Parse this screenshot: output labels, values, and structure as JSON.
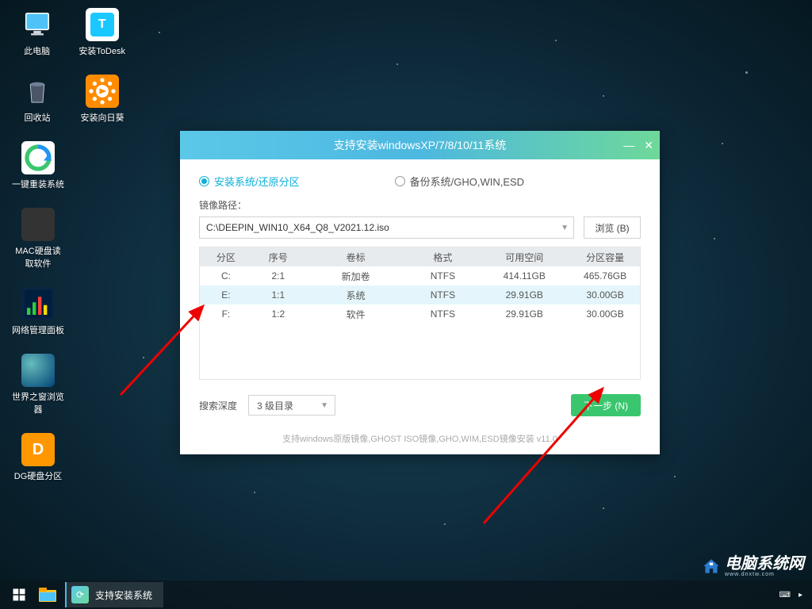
{
  "desktop": [
    [
      {
        "name": "pc",
        "label": "此电脑"
      },
      {
        "name": "todesk",
        "label": "安装ToDesk"
      }
    ],
    [
      {
        "name": "trash",
        "label": "回收站"
      },
      {
        "name": "sunflower",
        "label": "安装向日葵"
      }
    ],
    [
      {
        "name": "reinstall",
        "label": "一键重装系统"
      }
    ],
    [
      {
        "name": "mac",
        "label": "MAC硬盘读\n取软件"
      }
    ],
    [
      {
        "name": "netpanel",
        "label": "网络管理面板"
      }
    ],
    [
      {
        "name": "globe",
        "label": "世界之窗浏览\n器"
      }
    ],
    [
      {
        "name": "dg",
        "label": "DG硬盘分区"
      }
    ]
  ],
  "window": {
    "title": "支持安装windowsXP/7/8/10/11系统",
    "tab_install": "安装系统/还原分区",
    "tab_backup": "备份系统/GHO,WIN,ESD",
    "path_label": "镜像路径：",
    "path_value": "C:\\DEEPIN_WIN10_X64_Q8_V2021.12.iso",
    "browse": "浏览 (B)",
    "columns": {
      "drive": "分区",
      "seq": "序号",
      "label": "卷标",
      "fmt": "格式",
      "free": "可用空间",
      "cap": "分区容量"
    },
    "rows": [
      {
        "drive": "C:",
        "seq": "2:1",
        "label": "新加卷",
        "fmt": "NTFS",
        "free": "414.11GB",
        "cap": "465.76GB",
        "sel": false
      },
      {
        "drive": "E:",
        "seq": "1:1",
        "label": "系统",
        "fmt": "NTFS",
        "free": "29.91GB",
        "cap": "30.00GB",
        "sel": true
      },
      {
        "drive": "F:",
        "seq": "1:2",
        "label": "软件",
        "fmt": "NTFS",
        "free": "29.91GB",
        "cap": "30.00GB",
        "sel": false
      }
    ],
    "search_label": "搜索深度",
    "depth": "3 级目录",
    "next": "下一步 (N)",
    "support": "支持windows原版镜像,GHOST ISO镜像,GHO,WIM,ESD镜像安装 v11.0"
  },
  "taskbar": {
    "task": "支持安装系统"
  },
  "watermark": {
    "text": "电脑系统网",
    "sub": "www.dnxtw.com"
  }
}
